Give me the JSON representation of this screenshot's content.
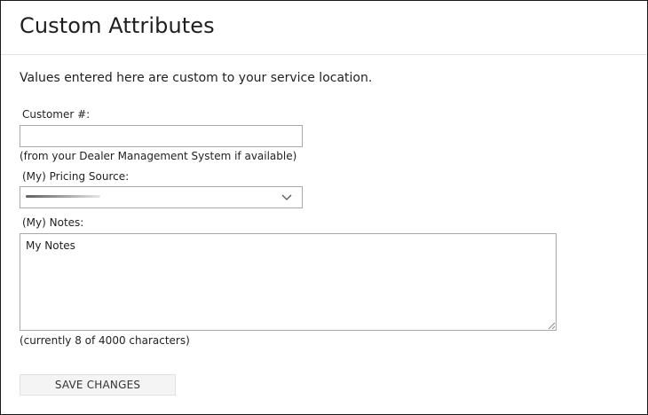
{
  "page": {
    "title": "Custom Attributes",
    "intro": "Values entered here are custom to your service location."
  },
  "form": {
    "customer_number": {
      "label": "Customer #:",
      "value": "",
      "help": "(from your Dealer Management System if available)"
    },
    "pricing_source": {
      "label": "(My) Pricing Source:",
      "selected_value": "",
      "icon": "chevron-down-icon"
    },
    "notes": {
      "label": "(My) Notes:",
      "value": "My Notes",
      "char_count_text": "(currently 8 of 4000 characters)"
    },
    "save_label": "SAVE CHANGES"
  },
  "colors": {
    "border": "#a9a9a9",
    "button_bg": "#f4f4f4",
    "text": "#222222"
  }
}
